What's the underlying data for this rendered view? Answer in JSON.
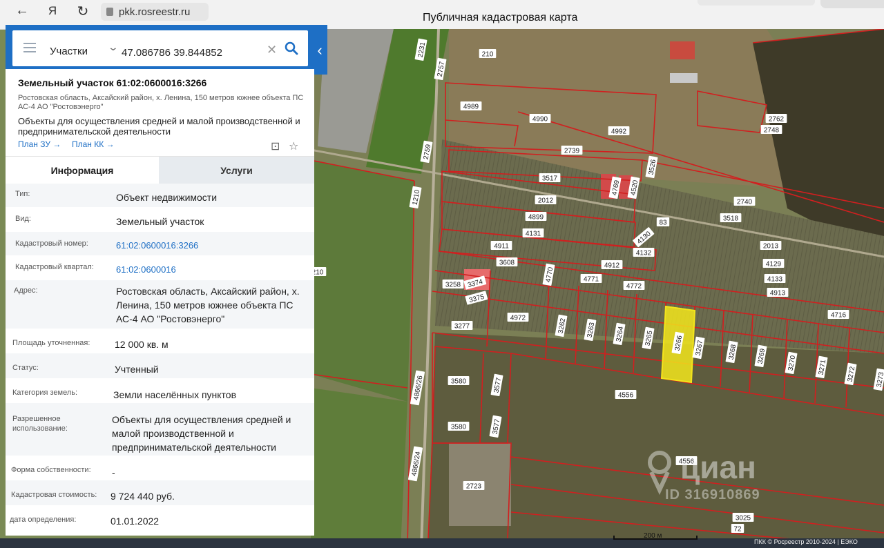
{
  "browser": {
    "url": "pkk.rosreestr.ru",
    "page_title": "Публичная кадастровая карта"
  },
  "search": {
    "layer": "Участки",
    "query": "47.086786 39.844852"
  },
  "parcel": {
    "title": "Земельный участок 61:02:0600016:3266",
    "address_short": "Ростовская область, Аксайский район, х. Ленина, 150 метров южнее объекта ПС АС-4 АО \"Ростовэнерго\"",
    "purpose": "Объекты для осуществления средней и малой производственной и предпринимательской деятельности",
    "plan_zu": "План ЗУ →",
    "plan_kk": "План КК →"
  },
  "tabs": {
    "info": "Информация",
    "services": "Услуги"
  },
  "fields": [
    {
      "label": "Тип:",
      "value": "Объект недвижимости"
    },
    {
      "label": "Вид:",
      "value": "Земельный участок"
    },
    {
      "label": "Кадастровый номер:",
      "value": "61:02:0600016:3266"
    },
    {
      "label": "Кадастровый квартал:",
      "value": "61:02:0600016"
    },
    {
      "label": "Адрес:",
      "value": "Ростовская область, Аксайский район, х. Ленина, 150 метров южнее объекта ПС АС-4 АО \"Ростовэнерго\""
    },
    {
      "label": "Площадь уточненная:",
      "value": "12 000 кв. м"
    },
    {
      "label": "Статус:",
      "value": "Учтенный"
    },
    {
      "label": "Категория земель:",
      "value": "Земли населённых пунктов"
    },
    {
      "label": "Разрешенное использование:",
      "value": "Объекты для осуществления средней и малой производственной и предпринимательской деятельности"
    },
    {
      "label": "Форма собственности:",
      "value": "-"
    },
    {
      "label": "Кадастровая стоимость:",
      "value": "9 724 440 руб."
    },
    {
      "label": "дата определения:",
      "value": "01.01.2022"
    }
  ],
  "map": {
    "scale": "200 м",
    "copyright": "ПКК © Росреестр 2010-2024 | ЕЭКО",
    "watermark": "циан",
    "watermark_id": "ID 316910869",
    "parcel_labels": [
      "2231",
      "2757",
      "210",
      "4989",
      "4990",
      "4992",
      "2762",
      "2748",
      "2739",
      "3526",
      "2759",
      "3517",
      "4769",
      "4520",
      "2012",
      "2740",
      "1210",
      "4899",
      "83",
      "3518",
      "4131",
      "4130",
      "2013",
      "4911",
      "4132",
      "3608",
      "4770",
      "4912",
      "4129",
      "210",
      "3258",
      "3374",
      "4771",
      "4772",
      "4133",
      "3375",
      "4913",
      "4972",
      "3262",
      "3263",
      "3264",
      "3265",
      "3266",
      "3267",
      "3268",
      "3269",
      "3270",
      "3271",
      "3272",
      "3273",
      "4716",
      "3277",
      "3580",
      "3577",
      "4556",
      "4866/26",
      "3580",
      "3577",
      "4866/24",
      "2723",
      "4556",
      "3025",
      "72"
    ]
  }
}
